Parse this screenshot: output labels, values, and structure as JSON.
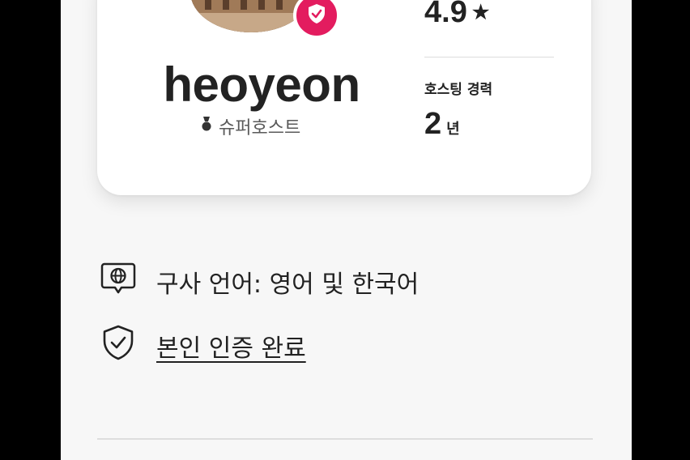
{
  "profile": {
    "name": "heoyeon",
    "superhost_label": "슈퍼호스트"
  },
  "stats": {
    "rating": "4.9",
    "rating_icon": "star-icon",
    "hosting_label": "호스팅 경력",
    "hosting_years": "2",
    "hosting_unit": "년"
  },
  "details": {
    "languages": "구사 언어: 영어 및 한국어",
    "languages_icon": "speech-globe-icon",
    "verified": "본인 인증 완료",
    "verified_icon": "shield-check-icon"
  },
  "colors": {
    "brand": "#e31c5f",
    "text": "#222222",
    "muted": "#5a5a5a"
  }
}
